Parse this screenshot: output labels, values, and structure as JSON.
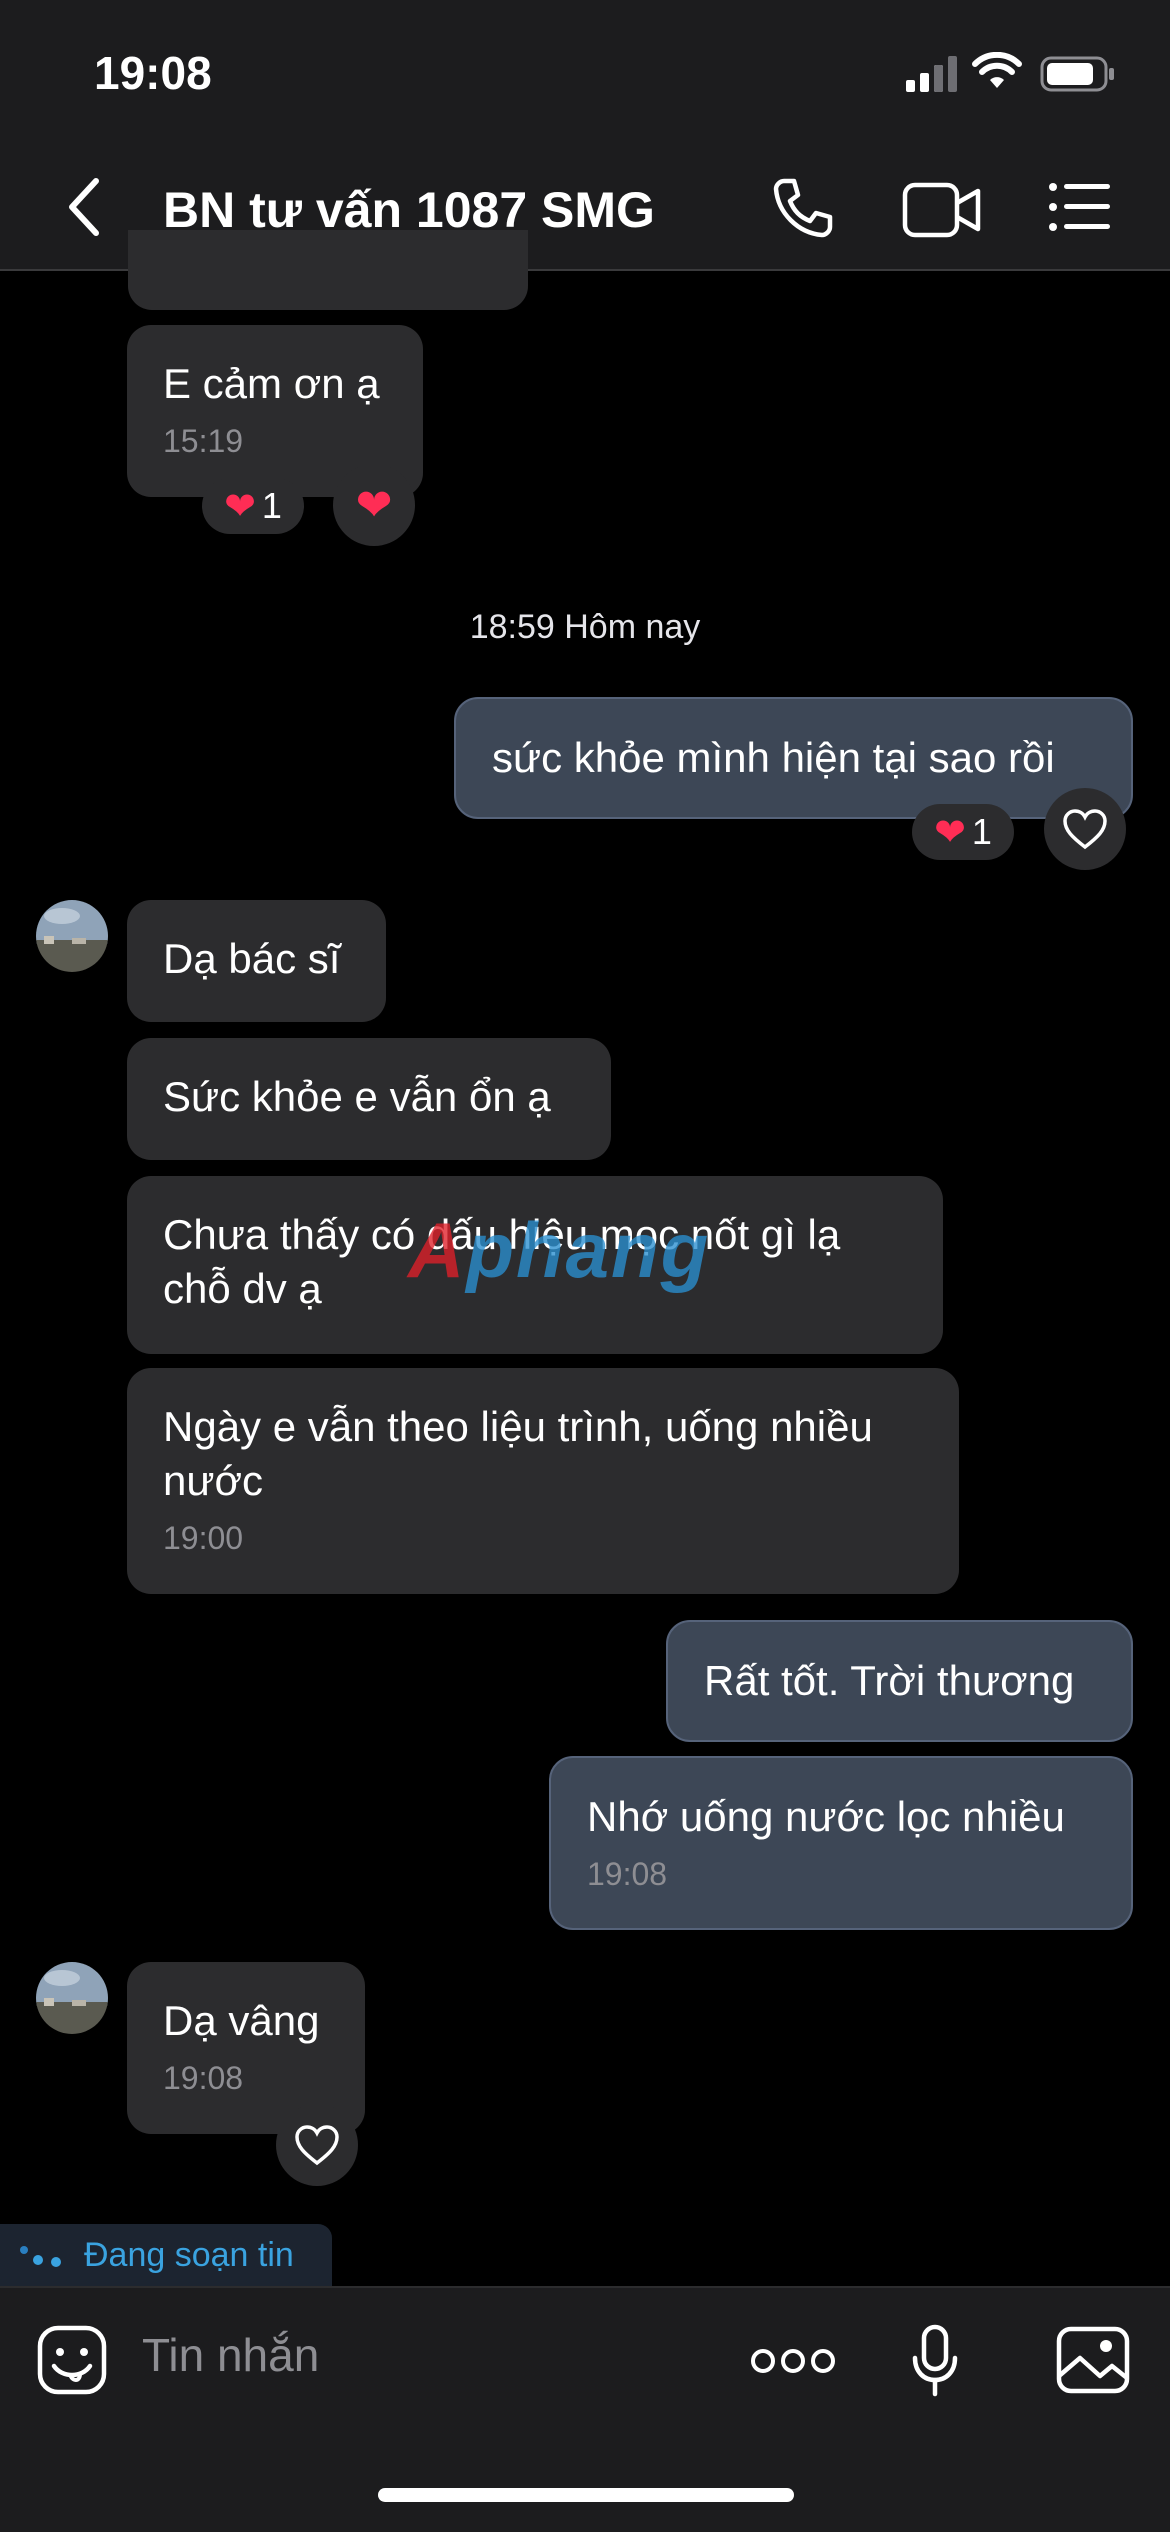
{
  "status": {
    "time": "19:08"
  },
  "header": {
    "title": "BN tư vấn 1087 SMG"
  },
  "messages": [
    {
      "text": "E cảm ơn ạ",
      "time": "15:19",
      "reaction_count": "1"
    },
    {
      "text": "sức khỏe mình hiện tại sao rồi",
      "reaction_count": "1"
    },
    {
      "text": "Dạ bác sĩ"
    },
    {
      "text": "Sức khỏe e vẫn ổn ạ"
    },
    {
      "line1": "Chưa thấy có dấu hiệu mọc nốt gì lạ",
      "line2": "chỗ dv ạ"
    },
    {
      "line1": "Ngày e vẫn theo liệu trình, uống nhiều",
      "line2": "nước",
      "time": "19:00"
    },
    {
      "text": "Rất tốt. Trời thương"
    },
    {
      "text": "Nhớ uống nước lọc nhiều",
      "time": "19:08"
    },
    {
      "text": "Dạ vâng",
      "time": "19:08"
    }
  ],
  "date_separator": "18:59 Hôm nay",
  "typing_indicator": "Đang soạn tin",
  "composer": {
    "placeholder": "Tin nhắn"
  },
  "watermark": {
    "a": "A",
    "rest": "phang"
  }
}
